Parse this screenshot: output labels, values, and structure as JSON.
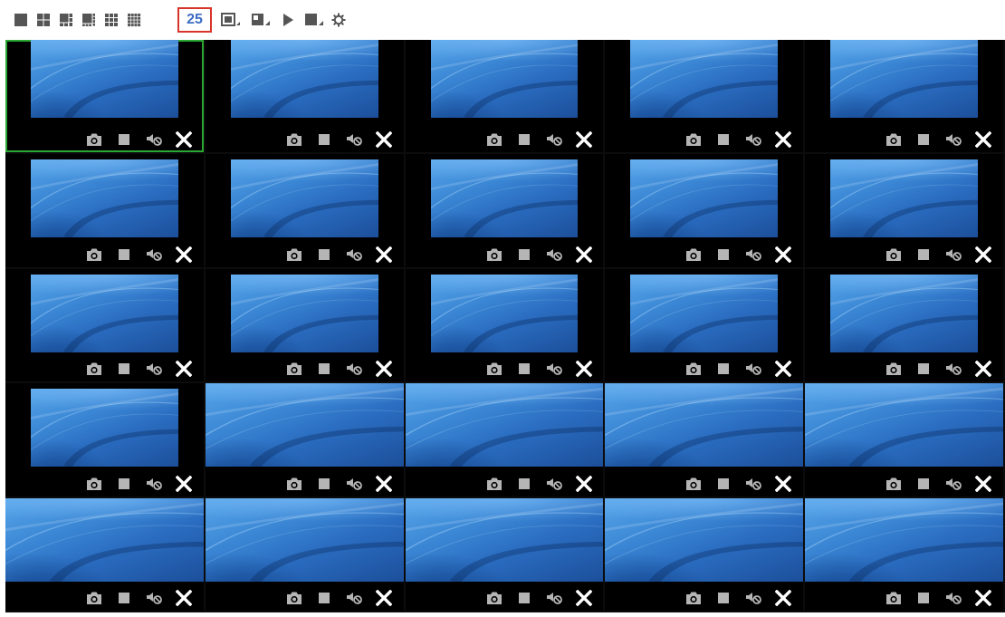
{
  "toolbar": {
    "layout_buttons": [
      {
        "name": "layout-1-button",
        "icon": "single-window-icon",
        "cells": 1
      },
      {
        "name": "layout-4-button",
        "icon": "quad-window-icon",
        "cells": 4
      },
      {
        "name": "layout-6-button",
        "icon": "six-window-icon",
        "cells": 6
      },
      {
        "name": "layout-8-button",
        "icon": "eight-window-icon",
        "cells": 8
      },
      {
        "name": "layout-9-button",
        "icon": "nine-window-icon",
        "cells": 9
      },
      {
        "name": "layout-16-button",
        "icon": "sixteen-window-icon",
        "cells": 16
      }
    ],
    "window_count_label": "25",
    "actions": [
      {
        "name": "fullscreen-button",
        "icon": "fullscreen-icon"
      },
      {
        "name": "window-mode-button",
        "icon": "window-mode-icon"
      },
      {
        "name": "play-button",
        "icon": "play-icon"
      },
      {
        "name": "stop-all-button",
        "icon": "stop-all-icon"
      },
      {
        "name": "settings-button",
        "icon": "gear-icon"
      }
    ]
  },
  "grid": {
    "rows": 5,
    "cols": 5,
    "active_tile": 1,
    "tile_controls": [
      "snapshot-icon",
      "stop-icon",
      "audio-icon",
      "close-icon"
    ]
  },
  "colors": {
    "accent_blue": "#3b6cc4",
    "highlight_red": "#d9342b",
    "active_green": "#2aa832",
    "tile_bg": "#000000",
    "icon_gray": "#b5b5b5",
    "toolbar_icon": "#555555"
  }
}
